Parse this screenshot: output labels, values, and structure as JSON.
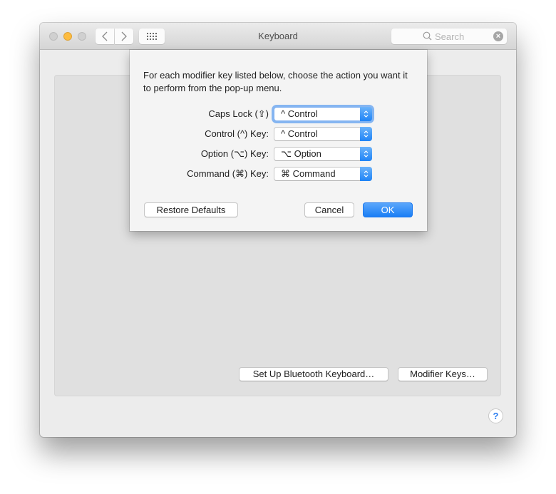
{
  "window": {
    "title": "Keyboard",
    "search": {
      "placeholder": "Search"
    },
    "traffic_lights": [
      "close",
      "minimize",
      "zoom"
    ],
    "nav": {
      "back_icon": "chevron-left-icon",
      "forward_icon": "chevron-right-icon",
      "grid_icon": "show-all-grid-icon"
    }
  },
  "panel": {
    "bluetooth_button": "Set Up Bluetooth Keyboard…",
    "modifier_button": "Modifier Keys…",
    "help": "?"
  },
  "sheet": {
    "intro": "For each modifier key listed below, choose the action you want it to perform from the pop-up menu.",
    "rows": [
      {
        "label": "Caps Lock (⇪)",
        "value": "^ Control"
      },
      {
        "label": "Control (^) Key:",
        "value": "^ Control"
      },
      {
        "label": "Option (⌥) Key:",
        "value": "⌥ Option"
      },
      {
        "label": "Command (⌘) Key:",
        "value": "⌘ Command"
      }
    ],
    "restore_defaults": "Restore Defaults",
    "cancel": "Cancel",
    "ok": "OK"
  },
  "colors": {
    "accent": "#1a7ef5",
    "minimize": "#fdbc40",
    "window_bg": "#ececec",
    "panel_bg": "#e0e0e0",
    "sheet_bg": "#f4f4f4"
  }
}
